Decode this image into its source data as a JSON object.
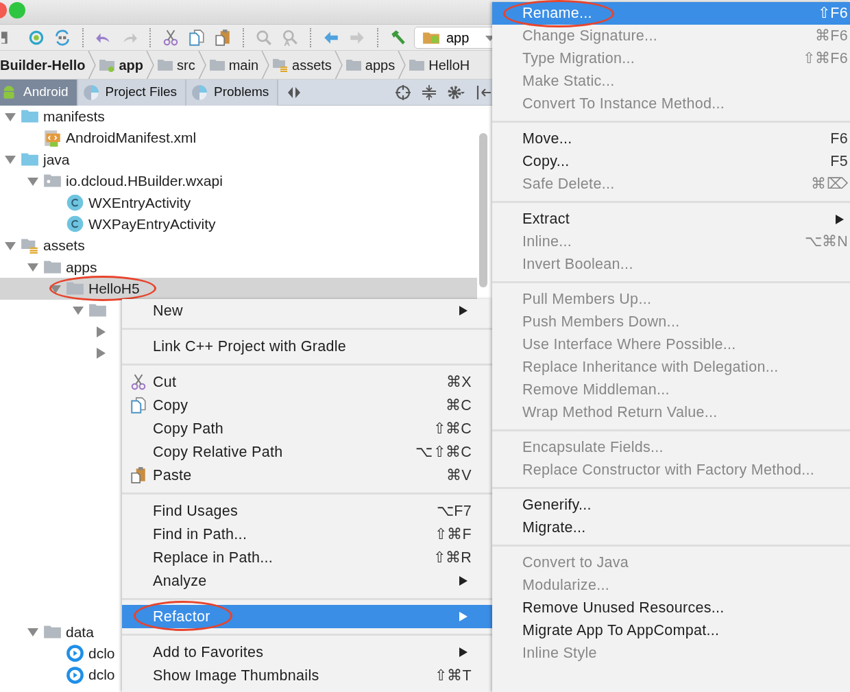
{
  "toolbar": {
    "run_config": "app"
  },
  "breadcrumbs": [
    {
      "label": "Builder-Hello",
      "kind": "project",
      "bold": true
    },
    {
      "label": "app",
      "kind": "module",
      "bold": true
    },
    {
      "label": "src",
      "kind": "directory",
      "bold": false
    },
    {
      "label": "main",
      "kind": "directory",
      "bold": false
    },
    {
      "label": "assets",
      "kind": "assets_directory",
      "bold": false
    },
    {
      "label": "apps",
      "kind": "directory",
      "bold": false
    },
    {
      "label": "HelloH",
      "kind": "directory",
      "bold": false
    }
  ],
  "tool_tabs": [
    {
      "label": "Android",
      "kind": "android_view",
      "selected": true
    },
    {
      "label": "Project Files",
      "kind": "scope_view",
      "selected": false
    },
    {
      "label": "Problems",
      "kind": "scope_view",
      "selected": false
    }
  ],
  "tree": [
    {
      "label": "manifests",
      "kind": "source_root",
      "expanded": true,
      "selected": false,
      "circled": false,
      "children": [
        {
          "label": "AndroidManifest.xml",
          "kind": "manifest_file",
          "selected": false,
          "circled": false
        }
      ]
    },
    {
      "label": "java",
      "kind": "source_root",
      "expanded": true,
      "selected": false,
      "circled": false,
      "children": [
        {
          "label": "io.dcloud.HBuilder.wxapi",
          "kind": "package",
          "expanded": true,
          "selected": false,
          "circled": false,
          "children": [
            {
              "label": "WXEntryActivity",
              "kind": "class",
              "selected": false,
              "circled": false
            },
            {
              "label": "WXPayEntryActivity",
              "kind": "class",
              "selected": false,
              "circled": false
            }
          ]
        }
      ]
    },
    {
      "label": "assets",
      "kind": "assets_directory",
      "expanded": true,
      "selected": false,
      "circled": false,
      "children": [
        {
          "label": "apps",
          "kind": "directory",
          "expanded": true,
          "selected": false,
          "circled": false,
          "children": [
            {
              "label": "HelloH5",
              "kind": "directory",
              "expanded": true,
              "selected": true,
              "circled": true,
              "children": [
                {
                  "kind": "directory",
                  "expanded": true,
                  "selected": false,
                  "circled": false,
                  "children": [
                    {
                      "expanded": false,
                      "selected": false,
                      "circled": false
                    },
                    {
                      "expanded": false,
                      "selected": false,
                      "circled": false
                    }
                  ]
                }
              ]
            }
          ]
        },
        {
          "label": "data",
          "kind": "directory",
          "expanded": true,
          "selected": false,
          "circled": false,
          "children": [
            {
              "label": "dclo",
              "kind": "web_app",
              "selected": false,
              "circled": false
            },
            {
              "label": "dclo",
              "kind": "web_app",
              "selected": false,
              "circled": false
            }
          ]
        }
      ]
    }
  ],
  "context_menu": {
    "groups": [
      {
        "items": [
          {
            "label": "New",
            "kind": "plain",
            "submenu": true,
            "selected": false,
            "disabled": false,
            "circled": false
          }
        ]
      },
      {
        "items": [
          {
            "label": "Link C++ Project with Gradle",
            "kind": "plain",
            "submenu": false,
            "selected": false,
            "disabled": false,
            "circled": false
          }
        ]
      },
      {
        "items": [
          {
            "label": "Cut",
            "shortcut": "⌘X",
            "kind": "cut",
            "submenu": false,
            "selected": false,
            "disabled": false,
            "circled": false
          },
          {
            "label": "Copy",
            "shortcut": "⌘C",
            "kind": "copy",
            "submenu": false,
            "selected": false,
            "disabled": false,
            "circled": false
          },
          {
            "label": "Copy Path",
            "shortcut": "⇧⌘C",
            "kind": "plain",
            "submenu": false,
            "selected": false,
            "disabled": false,
            "circled": false
          },
          {
            "label": "Copy Relative Path",
            "shortcut": "⌥⇧⌘C",
            "kind": "plain",
            "submenu": false,
            "selected": false,
            "disabled": false,
            "circled": false
          },
          {
            "label": "Paste",
            "shortcut": "⌘V",
            "kind": "paste",
            "submenu": false,
            "selected": false,
            "disabled": false,
            "circled": false
          }
        ]
      },
      {
        "items": [
          {
            "label": "Find Usages",
            "shortcut": "⌥F7",
            "kind": "plain",
            "submenu": false,
            "selected": false,
            "disabled": false,
            "circled": false
          },
          {
            "label": "Find in Path...",
            "shortcut": "⇧⌘F",
            "kind": "plain",
            "submenu": false,
            "selected": false,
            "disabled": false,
            "circled": false
          },
          {
            "label": "Replace in Path...",
            "shortcut": "⇧⌘R",
            "kind": "plain",
            "submenu": false,
            "selected": false,
            "disabled": false,
            "circled": false
          },
          {
            "label": "Analyze",
            "kind": "plain",
            "submenu": true,
            "selected": false,
            "disabled": false,
            "circled": false
          }
        ]
      },
      {
        "items": [
          {
            "label": "Refactor",
            "kind": "plain",
            "submenu": true,
            "selected": true,
            "disabled": false,
            "circled": true
          }
        ]
      },
      {
        "items": [
          {
            "label": "Add to Favorites",
            "kind": "plain",
            "submenu": true,
            "selected": false,
            "disabled": false,
            "circled": false
          },
          {
            "label": "Show Image Thumbnails",
            "shortcut": "⇧⌘T",
            "kind": "plain",
            "submenu": false,
            "selected": false,
            "disabled": false,
            "circled": false
          }
        ]
      }
    ]
  },
  "refactor_submenu": {
    "groups": [
      {
        "items": [
          {
            "label": "Rename...",
            "shortcut": "⇧F6",
            "submenu": false,
            "selected": true,
            "disabled": false,
            "circled": true
          },
          {
            "label": "Change Signature...",
            "shortcut": "⌘F6",
            "submenu": false,
            "selected": false,
            "disabled": true,
            "circled": false
          },
          {
            "label": "Type Migration...",
            "shortcut": "⇧⌘F6",
            "submenu": false,
            "selected": false,
            "disabled": true,
            "circled": false
          },
          {
            "label": "Make Static...",
            "submenu": false,
            "selected": false,
            "disabled": true,
            "circled": false
          },
          {
            "label": "Convert To Instance Method...",
            "submenu": false,
            "selected": false,
            "disabled": true,
            "circled": false
          }
        ]
      },
      {
        "items": [
          {
            "label": "Move...",
            "shortcut": "F6",
            "submenu": false,
            "selected": false,
            "disabled": false,
            "circled": false
          },
          {
            "label": "Copy...",
            "shortcut": "F5",
            "submenu": false,
            "selected": false,
            "disabled": false,
            "circled": false
          },
          {
            "label": "Safe Delete...",
            "shortcut": "⌘⌦",
            "submenu": false,
            "selected": false,
            "disabled": true,
            "circled": false
          }
        ]
      },
      {
        "items": [
          {
            "label": "Extract",
            "submenu": true,
            "selected": false,
            "disabled": false,
            "circled": false
          },
          {
            "label": "Inline...",
            "shortcut": "⌥⌘N",
            "submenu": false,
            "selected": false,
            "disabled": true,
            "circled": false
          },
          {
            "label": "Invert Boolean...",
            "submenu": false,
            "selected": false,
            "disabled": true,
            "circled": false
          }
        ]
      },
      {
        "items": [
          {
            "label": "Pull Members Up...",
            "submenu": false,
            "selected": false,
            "disabled": true,
            "circled": false
          },
          {
            "label": "Push Members Down...",
            "submenu": false,
            "selected": false,
            "disabled": true,
            "circled": false
          },
          {
            "label": "Use Interface Where Possible...",
            "submenu": false,
            "selected": false,
            "disabled": true,
            "circled": false
          },
          {
            "label": "Replace Inheritance with Delegation...",
            "submenu": false,
            "selected": false,
            "disabled": true,
            "circled": false
          },
          {
            "label": "Remove Middleman...",
            "submenu": false,
            "selected": false,
            "disabled": true,
            "circled": false
          },
          {
            "label": "Wrap Method Return Value...",
            "submenu": false,
            "selected": false,
            "disabled": true,
            "circled": false
          }
        ]
      },
      {
        "items": [
          {
            "label": "Encapsulate Fields...",
            "submenu": false,
            "selected": false,
            "disabled": true,
            "circled": false
          },
          {
            "label": "Replace Constructor with Factory Method...",
            "submenu": false,
            "selected": false,
            "disabled": true,
            "circled": false
          }
        ]
      },
      {
        "items": [
          {
            "label": "Generify...",
            "submenu": false,
            "selected": false,
            "disabled": false,
            "circled": false
          },
          {
            "label": "Migrate...",
            "submenu": false,
            "selected": false,
            "disabled": false,
            "circled": false
          }
        ]
      },
      {
        "items": [
          {
            "label": "Convert to Java",
            "submenu": false,
            "selected": false,
            "disabled": true,
            "circled": false
          },
          {
            "label": "Modularize...",
            "submenu": false,
            "selected": false,
            "disabled": true,
            "circled": false
          },
          {
            "label": "Remove Unused Resources...",
            "submenu": false,
            "selected": false,
            "disabled": false,
            "circled": false
          },
          {
            "label": "Migrate App To AppCompat...",
            "submenu": false,
            "selected": false,
            "disabled": false,
            "circled": false
          },
          {
            "label": "Inline Style",
            "submenu": false,
            "selected": false,
            "disabled": true,
            "circled": false
          }
        ]
      }
    ]
  }
}
